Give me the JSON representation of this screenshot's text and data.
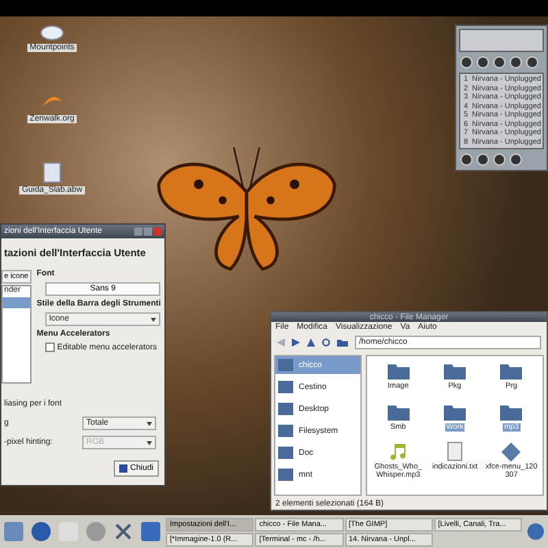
{
  "desktop_icons": [
    {
      "label": "Mountpoints",
      "kind": "drive"
    },
    {
      "label": "Zenwalk.org",
      "kind": "web"
    },
    {
      "label": "Guida_Slab.abw",
      "kind": "doc"
    }
  ],
  "settings_dialog": {
    "title": "zioni dell'Interfaccia Utente",
    "heading": "tazioni dell'Interfaccia Utente",
    "tab": "e icone",
    "list_items": [
      {
        "label": "nder",
        "selected": false
      },
      {
        "selected": true
      }
    ],
    "font_label": "Font",
    "font_button": "Sans 9",
    "toolbar_style_label": "Stile della Barra degli Strumenti",
    "toolbar_style_value": "Icone",
    "accelerators_label": "Menu Accelerators",
    "accelerators_checkbox": {
      "label": "Editable menu accelerators",
      "checked": false
    },
    "antialias_label": "liasing per i font",
    "hinting": {
      "label": "g",
      "value": "Totale",
      "disabled": false
    },
    "subpixel": {
      "label": "-pixel hinting:",
      "value": "RGB",
      "disabled": true
    },
    "close_button": "Chiudi"
  },
  "file_manager": {
    "title": "chicco - File Manager",
    "menu": [
      "File",
      "Modifica",
      "Visualizzazione",
      "Va",
      "Aiuto"
    ],
    "path": "/home/chicco",
    "places": [
      {
        "label": "chicco",
        "selected": true
      },
      {
        "label": "Cestino",
        "selected": false
      },
      {
        "label": "Desktop",
        "selected": false
      },
      {
        "label": "Filesystem",
        "selected": false
      },
      {
        "label": "Doc",
        "selected": false
      },
      {
        "label": "mnt",
        "selected": false
      }
    ],
    "files": [
      {
        "name": "Image",
        "kind": "folder",
        "selected": false
      },
      {
        "name": "Pkg",
        "kind": "folder",
        "selected": false
      },
      {
        "name": "Prg",
        "kind": "folder",
        "selected": false
      },
      {
        "name": "Smb",
        "kind": "folder",
        "selected": false
      },
      {
        "name": "Work",
        "kind": "folder",
        "selected": true
      },
      {
        "name": "mp3",
        "kind": "folder",
        "selected": true
      },
      {
        "name": "Ghosts_Who_Whisper.mp3",
        "kind": "audio",
        "selected": false
      },
      {
        "name": "indicazioni.txt",
        "kind": "text",
        "selected": false
      },
      {
        "name": "xfce-menu_120307",
        "kind": "package",
        "selected": false
      }
    ],
    "status": "2 elementi selezionati (164 B)"
  },
  "player": {
    "playlist": [
      {
        "number": "1",
        "title": "Nirvana - Unplugged"
      },
      {
        "number": "2",
        "title": "Nirvana - Unplugged"
      },
      {
        "number": "3",
        "title": "Nirvana - Unplugged"
      },
      {
        "number": "4",
        "title": "Nirvana - Unplugged"
      },
      {
        "number": "5",
        "title": "Nirvana - Unplugged"
      },
      {
        "number": "6",
        "title": "Nirvana - Unplugged"
      },
      {
        "number": "7",
        "title": "Nirvana - Unplugged"
      },
      {
        "number": "8",
        "title": "Nirvana - Unplugged"
      }
    ]
  },
  "taskbar": {
    "tasks": [
      {
        "label": "Impostazioni dell'I...",
        "selected": true
      },
      {
        "label": "chicco - File Mana...",
        "selected": false
      },
      {
        "label": "[The GIMP]",
        "selected": false
      },
      {
        "label": "[Livelli, Canali, Tra...",
        "selected": false
      },
      {
        "label": "[*Immagine-1.0 (R...",
        "selected": false
      },
      {
        "label": "[Terminal - mc - /h...",
        "selected": false
      },
      {
        "label": "14. Nirvana - Unpl...",
        "selected": false
      }
    ]
  }
}
